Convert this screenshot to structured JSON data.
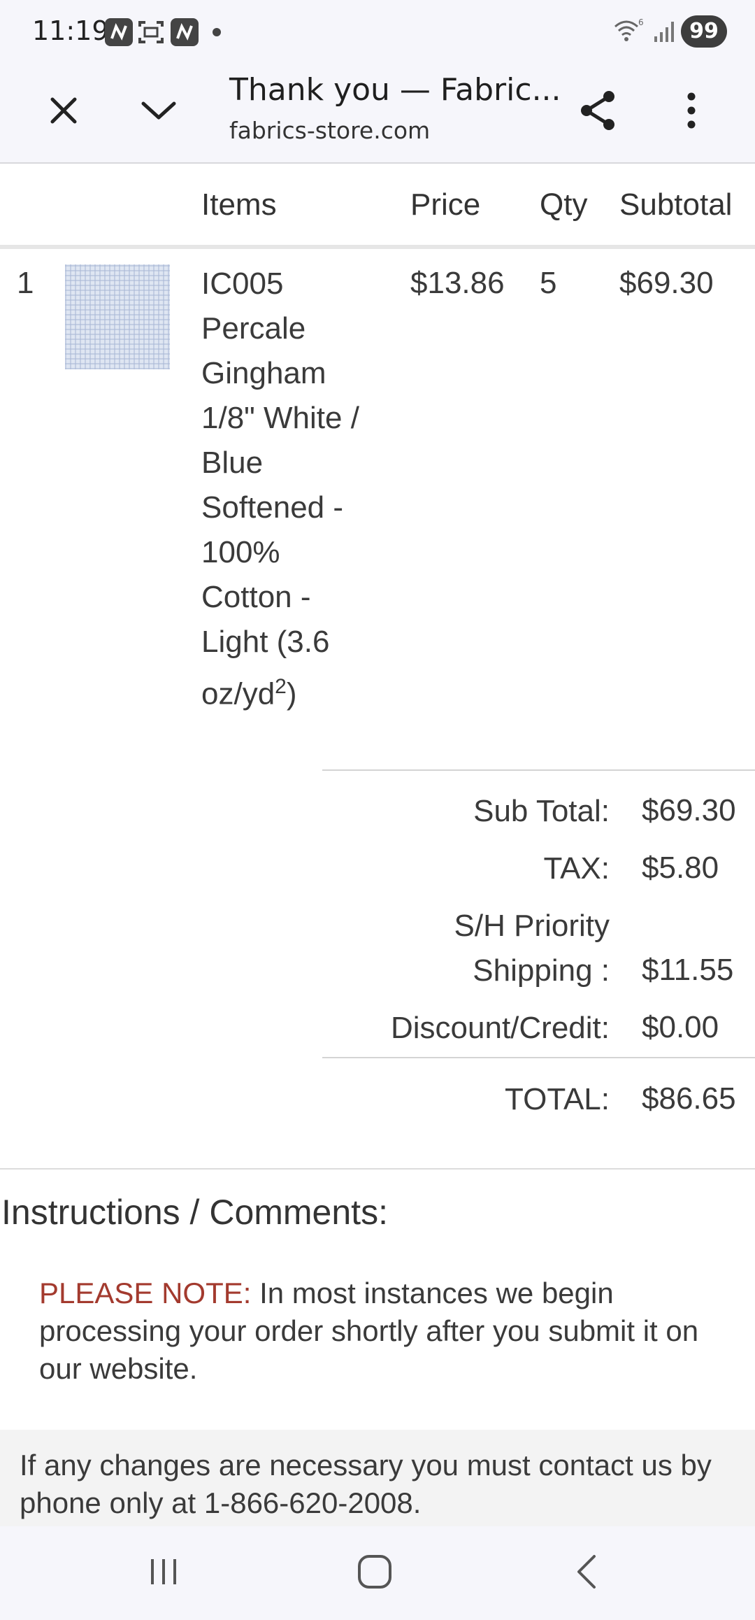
{
  "status_bar": {
    "time": "11:19",
    "battery": "99",
    "icons": [
      "notification-n-icon",
      "screenshot-icon",
      "notification-n-icon",
      "dot-icon",
      "wifi-6-icon",
      "signal-icon"
    ]
  },
  "toolbar": {
    "title": "Thank you — Fabric...",
    "url": "fabrics-store.com",
    "icons": [
      "close-icon",
      "chevron-down-icon",
      "share-icon",
      "more-vert-icon"
    ]
  },
  "table": {
    "headers": {
      "items": "Items",
      "price": "Price",
      "qty": "Qty",
      "subtotal": "Subtotal"
    },
    "rows": [
      {
        "num": "1",
        "desc_lines": [
          "IC005",
          "Percale",
          "Gingham",
          "1/8\" White /",
          "Blue",
          "Softened -",
          "100%",
          "Cotton -",
          "Light (3.6"
        ],
        "desc_last_prefix": "oz/yd",
        "desc_last_sup": "2",
        "desc_last_suffix": ")",
        "price": "$13.86",
        "qty": "5",
        "subtotal": "$69.30"
      }
    ]
  },
  "totals": {
    "subtotal_label": "Sub Total:",
    "subtotal_value": "$69.30",
    "tax_label": "TAX:",
    "tax_value": "$5.80",
    "shipping_label_1": "S/H Priority",
    "shipping_label_2": "Shipping :",
    "shipping_value": "$11.55",
    "discount_label": "Discount/Credit:",
    "discount_value": "$0.00",
    "total_label": "TOTAL:",
    "total_value": "$86.65"
  },
  "instructions": {
    "title": "Instructions / Comments:",
    "note_prefix": "PLEASE NOTE:",
    "note_text": " In most instances we begin processing your order shortly after you submit it on our website.",
    "phone_text": "If any changes are necessary you must contact us by phone only at 1-866-620-2008."
  },
  "colors": {
    "note_red": "#a33a2e",
    "chrome_bg": "#f6f6fb"
  },
  "navbar": {
    "icons": [
      "recent-apps-icon",
      "home-icon",
      "back-icon"
    ]
  }
}
